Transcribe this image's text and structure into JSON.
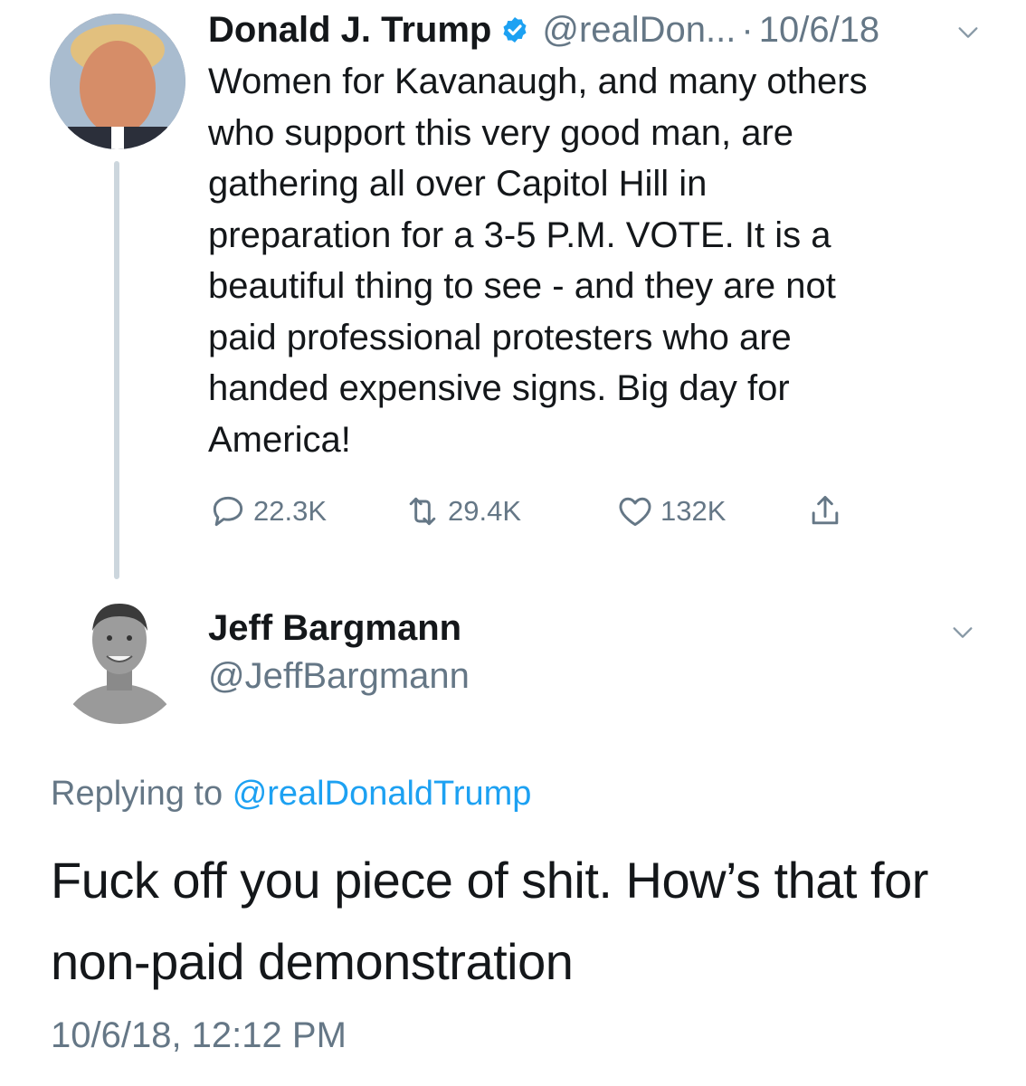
{
  "original_tweet": {
    "author_name": "Donald J. Trump",
    "author_handle": "@realDon...",
    "separator": "·",
    "date": "10/6/18",
    "text": "Women for Kavanaugh, and many others\nwho support this very good man, are\ngathering all over Capitol Hill in\npreparation for a 3-5 P.M. VOTE. It is a\nbeautiful thing to see - and they are not\npaid professional protesters who are\nhanded expensive signs. Big day for\nAmerica!",
    "reply_count": "22.3K",
    "retweet_count": "29.4K",
    "like_count": "132K"
  },
  "reply_tweet": {
    "author_name": "Jeff Bargmann",
    "author_handle": "@JeffBargmann",
    "replying_prefix": "Replying to",
    "replying_to": "@realDonaldTrump",
    "text": "Fuck off you piece of shit. How’s that for\nnon-paid demonstration",
    "timestamp": "10/6/18, 12:12 PM"
  },
  "colors": {
    "text_primary": "#14171a",
    "text_secondary": "#657786",
    "link": "#1da1f2",
    "verified_badge": "#1da1f2",
    "thread_line": "#ccd6dd"
  },
  "icons": {
    "verified": "verified-badge-icon",
    "menu": "chevron-down-icon",
    "reply": "reply-bubble-icon",
    "retweet": "retweet-icon",
    "like": "heart-icon",
    "share": "share-icon"
  }
}
